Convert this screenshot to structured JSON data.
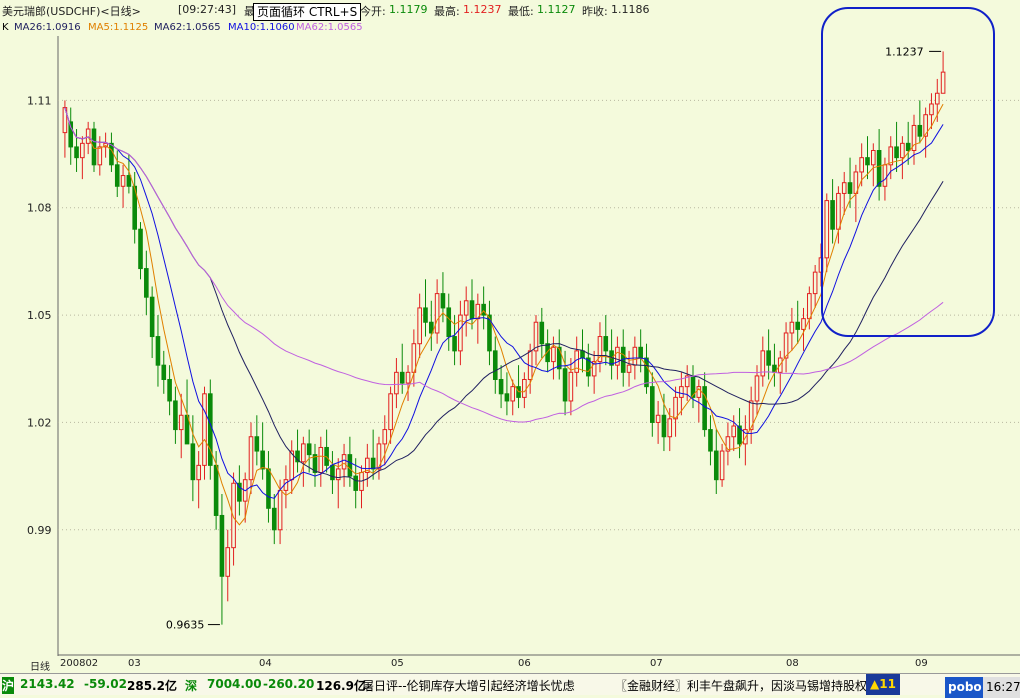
{
  "header": {
    "symbol_title": "美元瑞郎(USDCHF)<日线>",
    "time": "[09:27:43]",
    "fragment_left": "最",
    "fragment_right": "s",
    "open_label": "今开:",
    "open_value": "1.1179",
    "high_label": "最高:",
    "high_value": "1.1237",
    "low_label": "最低:",
    "low_value": "1.1127",
    "prev_close_label": "昨收:",
    "prev_close_value": "1.1186",
    "tooltip": "页面循环 CTRL+S"
  },
  "window_buttons": [
    "minimize-icon",
    "restore-icon",
    "close-icon"
  ],
  "ma_bar": {
    "k": "K",
    "ma26": "MA26:1.0916",
    "ma5": "MA5:1.1125",
    "ma62": "MA62:1.0565",
    "ma10": "MA10:1.1060",
    "ma62b": "MA62:1.0565"
  },
  "colors": {
    "background": "#f4fadc",
    "up": "#e22020",
    "down": "#0a8a0a",
    "ma5": "#e08000",
    "ma10": "#1010e0",
    "ma26": "#202060",
    "ma62": "#c060e0",
    "highlight": "#1020c8"
  },
  "chart_data": {
    "type": "candlestick",
    "ylim": [
      0.955,
      1.128
    ],
    "y_ticks": [
      "1.11",
      "1.08",
      "1.05",
      "1.02",
      "0.99"
    ],
    "y_tick_values": [
      1.11,
      1.08,
      1.05,
      1.02,
      0.99
    ],
    "x_ticks": [
      "日线",
      "200802",
      "03",
      "04",
      "05",
      "06",
      "07",
      "08",
      "09"
    ],
    "annotations": {
      "max": "1.1237",
      "min": "0.9635"
    },
    "max_value": 1.1237,
    "min_value": 0.9635,
    "ohlc": [
      [
        1.101,
        1.11,
        1.094,
        1.108
      ],
      [
        1.104,
        1.108,
        1.092,
        1.097
      ],
      [
        1.097,
        1.102,
        1.09,
        1.094
      ],
      [
        1.094,
        1.1,
        1.088,
        1.098
      ],
      [
        1.098,
        1.104,
        1.095,
        1.102
      ],
      [
        1.102,
        1.104,
        1.09,
        1.092
      ],
      [
        1.092,
        1.1,
        1.089,
        1.097
      ],
      [
        1.097,
        1.101,
        1.094,
        1.098
      ],
      [
        1.098,
        1.101,
        1.09,
        1.092
      ],
      [
        1.092,
        1.096,
        1.083,
        1.086
      ],
      [
        1.086,
        1.092,
        1.08,
        1.089
      ],
      [
        1.089,
        1.095,
        1.084,
        1.086
      ],
      [
        1.086,
        1.09,
        1.07,
        1.074
      ],
      [
        1.074,
        1.076,
        1.06,
        1.063
      ],
      [
        1.063,
        1.068,
        1.05,
        1.055
      ],
      [
        1.055,
        1.058,
        1.038,
        1.044
      ],
      [
        1.044,
        1.05,
        1.03,
        1.036
      ],
      [
        1.036,
        1.04,
        1.028,
        1.032
      ],
      [
        1.032,
        1.036,
        1.022,
        1.026
      ],
      [
        1.026,
        1.03,
        1.014,
        1.018
      ],
      [
        1.018,
        1.028,
        1.01,
        1.022
      ],
      [
        1.022,
        1.032,
        1.016,
        1.014
      ],
      [
        1.014,
        1.022,
        0.998,
        1.004
      ],
      [
        1.004,
        1.012,
        0.996,
        1.008
      ],
      [
        1.008,
        1.03,
        1.004,
        1.028
      ],
      [
        1.028,
        1.032,
        1.004,
        1.008
      ],
      [
        1.008,
        1.012,
        0.99,
        0.994
      ],
      [
        0.994,
        1.0,
        0.9635,
        0.977
      ],
      [
        0.977,
        0.99,
        0.97,
        0.985
      ],
      [
        0.985,
        1.006,
        0.98,
        1.003
      ],
      [
        1.003,
        1.008,
        0.994,
        0.998
      ],
      [
        0.998,
        1.006,
        0.992,
        1.004
      ],
      [
        1.004,
        1.02,
        1.0,
        1.016
      ],
      [
        1.016,
        1.022,
        1.008,
        1.012
      ],
      [
        1.012,
        1.02,
        1.004,
        1.007
      ],
      [
        1.007,
        1.012,
        0.992,
        0.996
      ],
      [
        0.996,
        1.0,
        0.986,
        0.99
      ],
      [
        0.99,
        1.004,
        0.986,
        1.001
      ],
      [
        1.001,
        1.008,
        0.996,
        1.004
      ],
      [
        1.004,
        1.015,
        1.0,
        1.012
      ],
      [
        1.012,
        1.018,
        1.006,
        1.009
      ],
      [
        1.009,
        1.016,
        1.002,
        1.014
      ],
      [
        1.014,
        1.018,
        1.006,
        1.011
      ],
      [
        1.011,
        1.014,
        1.002,
        1.006
      ],
      [
        1.006,
        1.016,
        1.002,
        1.013
      ],
      [
        1.013,
        1.018,
        1.006,
        1.008
      ],
      [
        1.008,
        1.012,
        1.0,
        1.004
      ],
      [
        1.004,
        1.01,
        0.996,
        1.007
      ],
      [
        1.007,
        1.014,
        1.002,
        1.011
      ],
      [
        1.011,
        1.016,
        1.002,
        1.005
      ],
      [
        1.005,
        1.01,
        0.996,
        1.001
      ],
      [
        1.001,
        1.008,
        0.996,
        1.006
      ],
      [
        1.006,
        1.014,
        1.002,
        1.01
      ],
      [
        1.01,
        1.018,
        1.004,
        1.007
      ],
      [
        1.007,
        1.016,
        1.004,
        1.014
      ],
      [
        1.014,
        1.022,
        1.008,
        1.018
      ],
      [
        1.018,
        1.03,
        1.014,
        1.028
      ],
      [
        1.028,
        1.038,
        1.024,
        1.034
      ],
      [
        1.034,
        1.042,
        1.028,
        1.031
      ],
      [
        1.031,
        1.036,
        1.026,
        1.034
      ],
      [
        1.034,
        1.046,
        1.03,
        1.042
      ],
      [
        1.042,
        1.056,
        1.038,
        1.052
      ],
      [
        1.052,
        1.06,
        1.044,
        1.048
      ],
      [
        1.048,
        1.054,
        1.04,
        1.045
      ],
      [
        1.045,
        1.06,
        1.042,
        1.056
      ],
      [
        1.056,
        1.062,
        1.048,
        1.052
      ],
      [
        1.052,
        1.056,
        1.04,
        1.044
      ],
      [
        1.044,
        1.05,
        1.036,
        1.04
      ],
      [
        1.04,
        1.054,
        1.036,
        1.05
      ],
      [
        1.05,
        1.058,
        1.044,
        1.054
      ],
      [
        1.054,
        1.06,
        1.046,
        1.049
      ],
      [
        1.049,
        1.056,
        1.042,
        1.053
      ],
      [
        1.053,
        1.058,
        1.046,
        1.05
      ],
      [
        1.05,
        1.054,
        1.036,
        1.04
      ],
      [
        1.04,
        1.044,
        1.028,
        1.032
      ],
      [
        1.032,
        1.036,
        1.024,
        1.028
      ],
      [
        1.028,
        1.034,
        1.022,
        1.026
      ],
      [
        1.026,
        1.032,
        1.022,
        1.03
      ],
      [
        1.03,
        1.036,
        1.024,
        1.027
      ],
      [
        1.027,
        1.034,
        1.024,
        1.032
      ],
      [
        1.032,
        1.042,
        1.028,
        1.04
      ],
      [
        1.04,
        1.05,
        1.036,
        1.048
      ],
      [
        1.048,
        1.052,
        1.038,
        1.042
      ],
      [
        1.042,
        1.046,
        1.034,
        1.037
      ],
      [
        1.037,
        1.044,
        1.032,
        1.041
      ],
      [
        1.041,
        1.046,
        1.032,
        1.035
      ],
      [
        1.035,
        1.04,
        1.022,
        1.026
      ],
      [
        1.026,
        1.038,
        1.022,
        1.034
      ],
      [
        1.034,
        1.044,
        1.03,
        1.04
      ],
      [
        1.04,
        1.046,
        1.034,
        1.038
      ],
      [
        1.038,
        1.042,
        1.03,
        1.033
      ],
      [
        1.033,
        1.04,
        1.028,
        1.037
      ],
      [
        1.037,
        1.048,
        1.034,
        1.044
      ],
      [
        1.044,
        1.05,
        1.036,
        1.04
      ],
      [
        1.04,
        1.046,
        1.032,
        1.036
      ],
      [
        1.036,
        1.044,
        1.032,
        1.041
      ],
      [
        1.041,
        1.046,
        1.03,
        1.034
      ],
      [
        1.034,
        1.04,
        1.03,
        1.036
      ],
      [
        1.036,
        1.044,
        1.032,
        1.041
      ],
      [
        1.041,
        1.046,
        1.034,
        1.038
      ],
      [
        1.038,
        1.042,
        1.028,
        1.03
      ],
      [
        1.03,
        1.034,
        1.016,
        1.02
      ],
      [
        1.02,
        1.026,
        1.014,
        1.022
      ],
      [
        1.022,
        1.028,
        1.012,
        1.016
      ],
      [
        1.016,
        1.024,
        1.012,
        1.021
      ],
      [
        1.021,
        1.03,
        1.016,
        1.027
      ],
      [
        1.027,
        1.034,
        1.022,
        1.03
      ],
      [
        1.03,
        1.036,
        1.026,
        1.033
      ],
      [
        1.033,
        1.036,
        1.024,
        1.027
      ],
      [
        1.027,
        1.032,
        1.02,
        1.03
      ],
      [
        1.03,
        1.034,
        1.016,
        1.018
      ],
      [
        1.018,
        1.022,
        1.008,
        1.012
      ],
      [
        1.012,
        1.018,
        1.0,
        1.004
      ],
      [
        1.004,
        1.014,
        1.002,
        1.012
      ],
      [
        1.012,
        1.02,
        1.008,
        1.016
      ],
      [
        1.016,
        1.022,
        1.012,
        1.019
      ],
      [
        1.019,
        1.024,
        1.01,
        1.014
      ],
      [
        1.014,
        1.022,
        1.008,
        1.018
      ],
      [
        1.018,
        1.03,
        1.014,
        1.026
      ],
      [
        1.026,
        1.036,
        1.022,
        1.033
      ],
      [
        1.033,
        1.044,
        1.03,
        1.04
      ],
      [
        1.04,
        1.046,
        1.032,
        1.036
      ],
      [
        1.036,
        1.042,
        1.03,
        1.034
      ],
      [
        1.034,
        1.04,
        1.028,
        1.038
      ],
      [
        1.038,
        1.048,
        1.034,
        1.045
      ],
      [
        1.045,
        1.052,
        1.04,
        1.048
      ],
      [
        1.048,
        1.054,
        1.042,
        1.046
      ],
      [
        1.046,
        1.052,
        1.04,
        1.049
      ],
      [
        1.049,
        1.058,
        1.046,
        1.056
      ],
      [
        1.056,
        1.064,
        1.052,
        1.062
      ],
      [
        1.062,
        1.07,
        1.058,
        1.066
      ],
      [
        1.066,
        1.084,
        1.062,
        1.082
      ],
      [
        1.082,
        1.088,
        1.07,
        1.074
      ],
      [
        1.074,
        1.086,
        1.07,
        1.084
      ],
      [
        1.084,
        1.09,
        1.078,
        1.087
      ],
      [
        1.087,
        1.094,
        1.08,
        1.084
      ],
      [
        1.084,
        1.092,
        1.076,
        1.09
      ],
      [
        1.09,
        1.098,
        1.086,
        1.094
      ],
      [
        1.094,
        1.1,
        1.088,
        1.092
      ],
      [
        1.092,
        1.098,
        1.086,
        1.096
      ],
      [
        1.096,
        1.102,
        1.082,
        1.086
      ],
      [
        1.086,
        1.094,
        1.082,
        1.092
      ],
      [
        1.092,
        1.1,
        1.088,
        1.097
      ],
      [
        1.097,
        1.104,
        1.09,
        1.094
      ],
      [
        1.094,
        1.1,
        1.088,
        1.098
      ],
      [
        1.098,
        1.104,
        1.092,
        1.096
      ],
      [
        1.096,
        1.106,
        1.092,
        1.103
      ],
      [
        1.103,
        1.11,
        1.098,
        1.1
      ],
      [
        1.1,
        1.108,
        1.094,
        1.106
      ],
      [
        1.106,
        1.112,
        1.102,
        1.109
      ],
      [
        1.109,
        1.116,
        1.104,
        1.112
      ],
      [
        1.112,
        1.1237,
        1.1127,
        1.1179
      ]
    ]
  },
  "highlight_box_label": "",
  "ticker": {
    "sh_label": "沪",
    "sh_index": "2143.42",
    "sh_change": "-59.02",
    "sh_turnover": "285.2亿",
    "sz_label": "深",
    "sz_index": "7004.00",
    "sz_change": "-260.20",
    "sz_turnover": "126.9亿",
    "news1": "屠日评--伦铜库存大增引起经济增长忧虑",
    "news2": "〖金融财经〗利丰午盘飙升，因淡马锡增持股权",
    "alert": "▲11",
    "brand": "pobo",
    "clock": "16:27"
  }
}
